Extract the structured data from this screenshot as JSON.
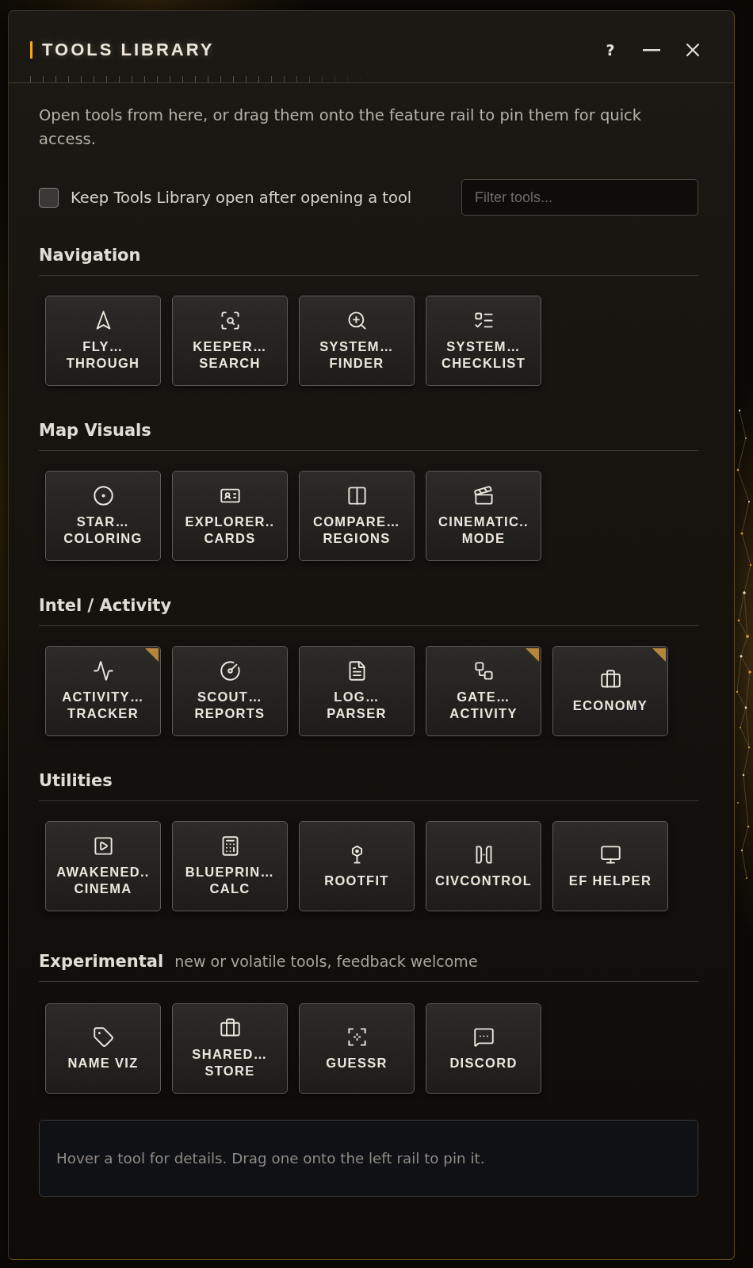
{
  "window": {
    "title": "TOOLS LIBRARY",
    "help_label": "?"
  },
  "description": "Open tools from here, or drag them onto the feature rail to pin them for quick access.",
  "keep_open": {
    "label": "Keep Tools Library open after opening a tool",
    "checked": false
  },
  "filter": {
    "placeholder": "Filter tools..."
  },
  "sections": [
    {
      "title": "Navigation",
      "tools": [
        {
          "label": [
            "FLY…",
            "THROUGH"
          ],
          "flagged": false
        },
        {
          "label": [
            "KEEPER…",
            "SEARCH"
          ],
          "flagged": false
        },
        {
          "label": [
            "SYSTEM…",
            "FINDER"
          ],
          "flagged": false
        },
        {
          "label": [
            "SYSTEM…",
            "CHECKLIST"
          ],
          "flagged": false
        }
      ]
    },
    {
      "title": "Map Visuals",
      "tools": [
        {
          "label": [
            "STAR…",
            "COLORING"
          ],
          "flagged": false
        },
        {
          "label": [
            "EXPLORER..",
            "CARDS"
          ],
          "flagged": false
        },
        {
          "label": [
            "COMPARE…",
            "REGIONS"
          ],
          "flagged": false
        },
        {
          "label": [
            "CINEMATIC..",
            "MODE"
          ],
          "flagged": false
        }
      ]
    },
    {
      "title": "Intel / Activity",
      "tools": [
        {
          "label": [
            "ACTIVITY…",
            "TRACKER"
          ],
          "flagged": true
        },
        {
          "label": [
            "SCOUT…",
            "REPORTS"
          ],
          "flagged": false
        },
        {
          "label": [
            "LOG…",
            "PARSER"
          ],
          "flagged": false
        },
        {
          "label": [
            "GATE…",
            "ACTIVITY"
          ],
          "flagged": true
        },
        {
          "label": [
            "ECONOMY"
          ],
          "flagged": true
        }
      ]
    },
    {
      "title": "Utilities",
      "tools": [
        {
          "label": [
            "AWAKENED..",
            "CINEMA"
          ],
          "flagged": false
        },
        {
          "label": [
            "BLUEPRIN…",
            "CALC"
          ],
          "flagged": false
        },
        {
          "label": [
            "ROOTFIT"
          ],
          "flagged": false
        },
        {
          "label": [
            "CIVCONTROL"
          ],
          "flagged": false
        },
        {
          "label": [
            "EF HELPER"
          ],
          "flagged": false
        }
      ]
    },
    {
      "title": "Experimental",
      "subtitle": "new or volatile tools, feedback welcome",
      "tools": [
        {
          "label": [
            "NAME VIZ"
          ],
          "flagged": false
        },
        {
          "label": [
            "SHARED…",
            "STORE"
          ],
          "flagged": false
        },
        {
          "label": [
            "GUESSR"
          ],
          "flagged": false
        },
        {
          "label": [
            "DISCORD"
          ],
          "flagged": false
        }
      ]
    }
  ],
  "info": "Hover a tool for details. Drag one onto the left rail to pin it."
}
